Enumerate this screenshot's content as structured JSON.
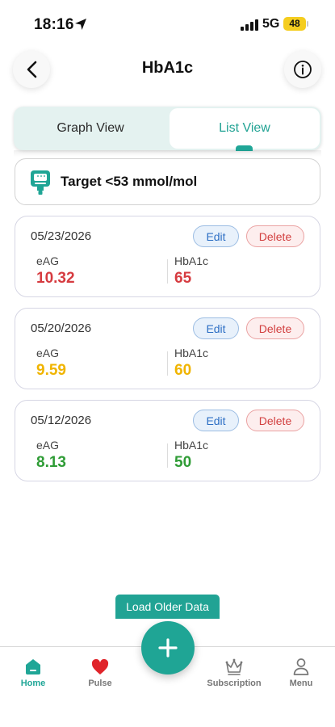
{
  "status_bar": {
    "time": "18:16",
    "network": "5G",
    "battery": "48"
  },
  "header": {
    "title": "HbA1c"
  },
  "view_toggle": {
    "graph_label": "Graph View",
    "list_label": "List View",
    "selected": "List View"
  },
  "target": {
    "text": "Target <53 mmol/mol"
  },
  "entries": [
    {
      "date": "05/23/2026",
      "edit_label": "Edit",
      "delete_label": "Delete",
      "eag_label": "eAG",
      "eag_value": "10.32",
      "hba1c_label": "HbA1c",
      "hba1c_value": "65",
      "status_color": "#d63b40"
    },
    {
      "date": "05/20/2026",
      "edit_label": "Edit",
      "delete_label": "Delete",
      "eag_label": "eAG",
      "eag_value": "9.59",
      "hba1c_label": "HbA1c",
      "hba1c_value": "60",
      "status_color": "#f0b400"
    },
    {
      "date": "05/12/2026",
      "edit_label": "Edit",
      "delete_label": "Delete",
      "eag_label": "eAG",
      "eag_value": "8.13",
      "hba1c_label": "HbA1c",
      "hba1c_value": "50",
      "status_color": "#2f9c36"
    }
  ],
  "load_older_label": "Load Older Data",
  "bottom_nav": {
    "items": [
      {
        "label": "Home",
        "icon": "home-icon",
        "active": true
      },
      {
        "label": "Pulse",
        "icon": "heart-icon",
        "active": false
      },
      {
        "label": "Subscription",
        "icon": "crown-icon",
        "active": false
      },
      {
        "label": "Menu",
        "icon": "person-icon",
        "active": false
      }
    ],
    "fab_icon": "plus-icon"
  },
  "colors": {
    "accent": "#20a697",
    "edit": "#2d6fc4",
    "delete": "#d23f3f"
  }
}
